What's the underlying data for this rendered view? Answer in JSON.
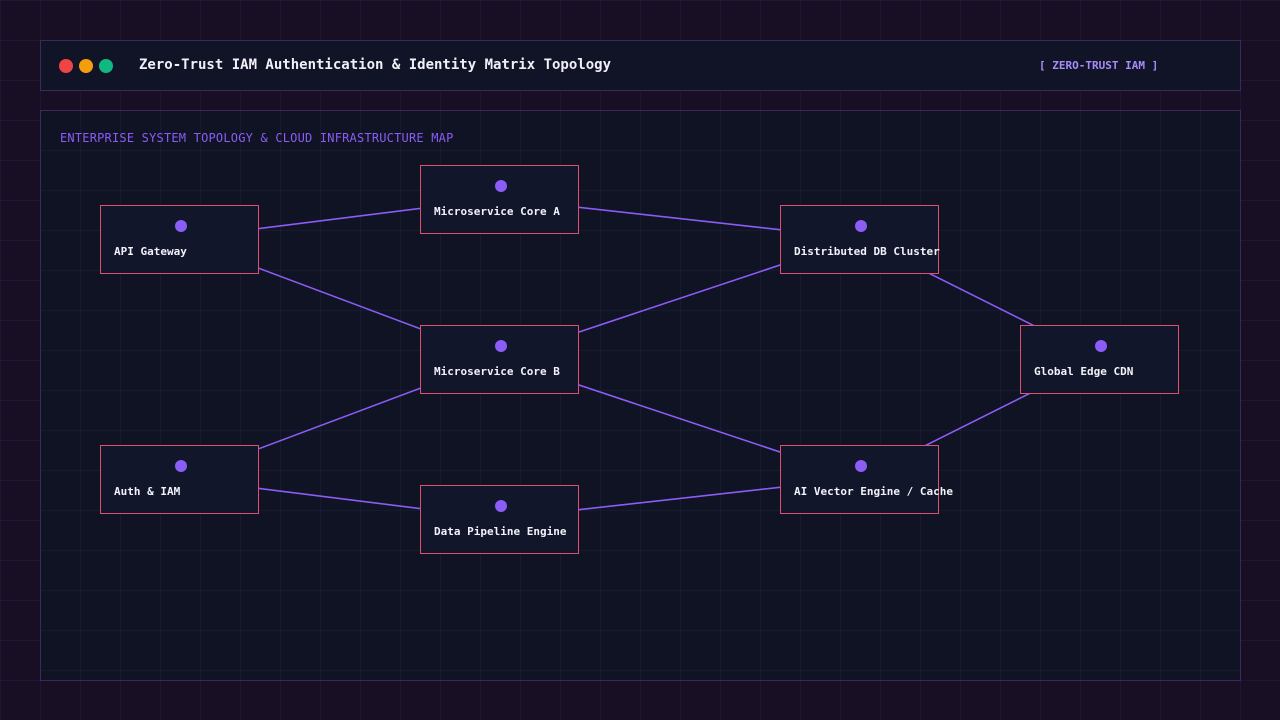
{
  "window": {
    "title": "Zero-Trust IAM Authentication & Identity Matrix Topology",
    "badge": "[ ZERO-TRUST IAM ]",
    "controls": [
      {
        "name": "close-dot",
        "color": "#ef4444"
      },
      {
        "name": "minimize-dot",
        "color": "#f59e0b"
      },
      {
        "name": "maximize-dot",
        "color": "#10b981"
      }
    ]
  },
  "panel": {
    "title": "ENTERPRISE SYSTEM TOPOLOGY & CLOUD INFRASTRUCTURE MAP"
  },
  "colors": {
    "accent": "#8b5cf6",
    "node_border": "#e0506e",
    "edge": "#8b5cf6"
  },
  "nodes": [
    {
      "id": "api-gateway",
      "label": "API Gateway"
    },
    {
      "id": "microservice-core-a",
      "label": "Microservice Core A"
    },
    {
      "id": "distributed-db-cluster",
      "label": "Distributed DB Cluster"
    },
    {
      "id": "microservice-core-b",
      "label": "Microservice Core B"
    },
    {
      "id": "global-edge-cdn",
      "label": "Global Edge CDN"
    },
    {
      "id": "auth-iam",
      "label": "Auth & IAM"
    },
    {
      "id": "data-pipeline-engine",
      "label": "Data Pipeline Engine"
    },
    {
      "id": "ai-vector-engine-cache",
      "label": "AI Vector Engine / Cache"
    }
  ],
  "edges": [
    {
      "from": "api-gateway",
      "to": "microservice-core-a"
    },
    {
      "from": "api-gateway",
      "to": "microservice-core-b"
    },
    {
      "from": "microservice-core-a",
      "to": "distributed-db-cluster"
    },
    {
      "from": "microservice-core-b",
      "to": "distributed-db-cluster"
    },
    {
      "from": "microservice-core-b",
      "to": "ai-vector-engine-cache"
    },
    {
      "from": "auth-iam",
      "to": "microservice-core-b"
    },
    {
      "from": "auth-iam",
      "to": "data-pipeline-engine"
    },
    {
      "from": "data-pipeline-engine",
      "to": "ai-vector-engine-cache"
    },
    {
      "from": "distributed-db-cluster",
      "to": "global-edge-cdn"
    },
    {
      "from": "ai-vector-engine-cache",
      "to": "global-edge-cdn"
    }
  ]
}
